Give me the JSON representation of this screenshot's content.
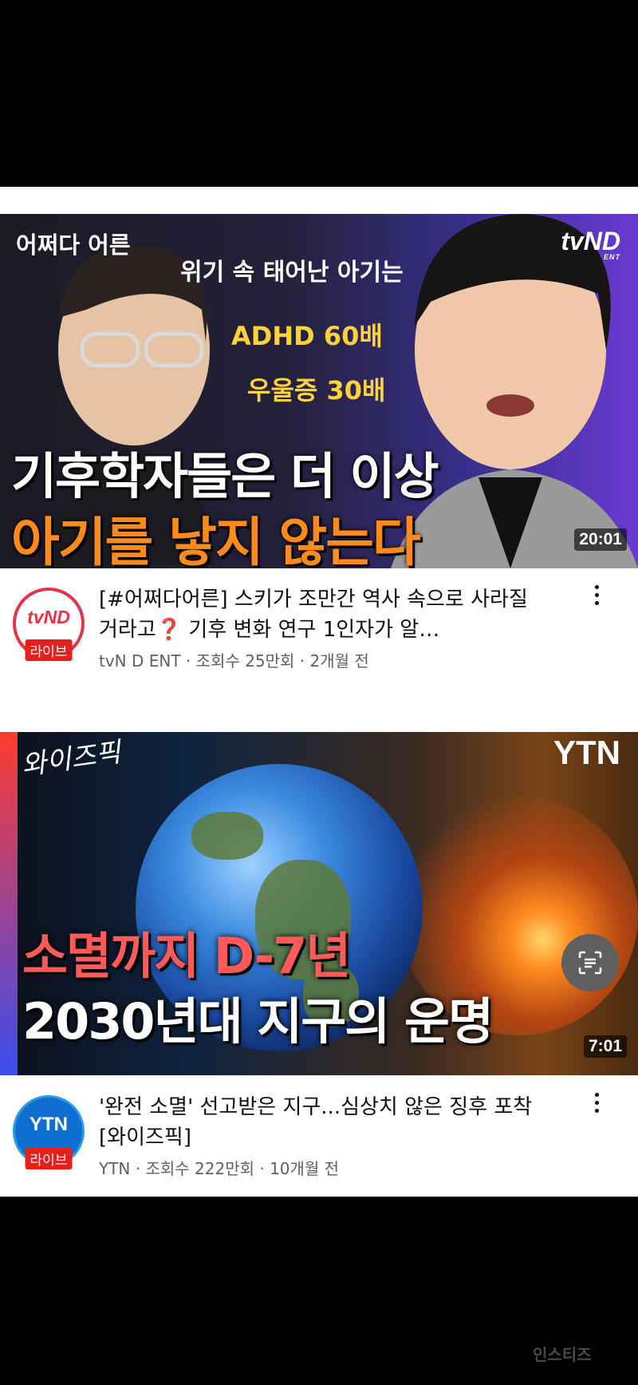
{
  "videos": [
    {
      "thumbnail": {
        "show_logo": "어쩌다 어른",
        "channel_watermark": "tvND",
        "channel_watermark_sub": "ENT",
        "caption_top": "위기 속 태어난 아기는",
        "caption_line2": "ADHD 60배",
        "caption_line3": "우울증 30배",
        "headline_1": "기후학자들은 더 이상",
        "headline_2": "아기를 낳지 않는다",
        "duration": "20:01"
      },
      "title": "[#어쩌다어른] 스키가 조만간 역사 속으로 사라질 거라고❓ 기후 변화 연구 1인자가 알…",
      "channel": "tvN D ENT",
      "views": "조회수 25만회",
      "age": "2개월 전",
      "meta_line": "tvN D ENT · 조회수 25만회 · 2개월 전",
      "avatar_brand": "tvND",
      "avatar_badge": "라이브",
      "more_icon": "more-vert-icon"
    },
    {
      "thumbnail": {
        "show_logo": "와이즈픽",
        "channel_watermark": "YTN",
        "headline_1": "소멸까지 D-7년",
        "headline_2": "2030년대 지구의 운명",
        "duration": "7:01"
      },
      "title": "'완전 소멸' 선고받은 지구...심상치 않은 징후 포착 [와이즈픽]",
      "channel": "YTN",
      "views": "조회수 222만회",
      "age": "10개월 전",
      "meta_line": "YTN · 조회수 222만회 · 10개월 전",
      "avatar_brand": "YTN",
      "avatar_badge": "라이브",
      "more_icon": "more-vert-icon"
    }
  ],
  "floating_button": {
    "icon": "lens-scan-icon"
  },
  "watermark": "인스티즈",
  "colors": {
    "live_badge": "#e3201b",
    "tvnd_red": "#e3344a",
    "ytn_blue": "#0f6fd1",
    "meta_text": "#606060"
  }
}
